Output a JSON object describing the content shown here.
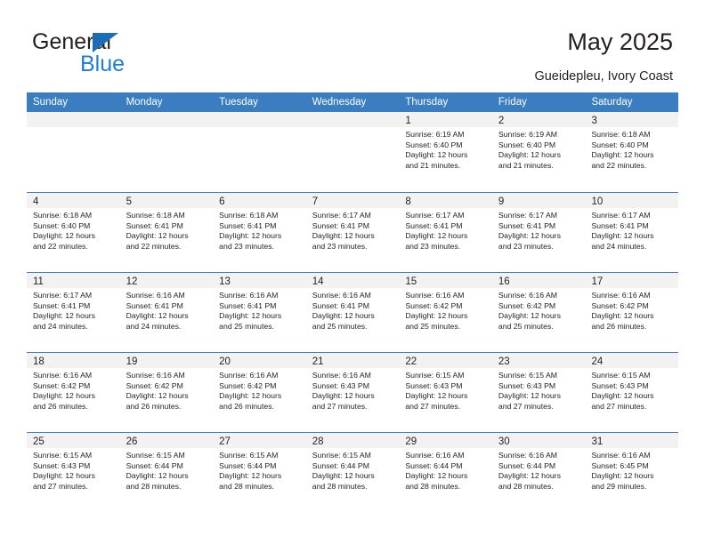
{
  "brand": {
    "name_part1": "General",
    "name_part2": "Blue",
    "triangle_color": "#1b6cb5",
    "blue_text_color": "#1b7fd4"
  },
  "header": {
    "title": "May 2025",
    "subtitle": "Gueidepleu, Ivory Coast"
  },
  "theme": {
    "header_blue": "#3a7dc0",
    "day_band_gray": "#f2f2f2",
    "text_color": "#231f20"
  },
  "calendar": {
    "weekdays": [
      "Sunday",
      "Monday",
      "Tuesday",
      "Wednesday",
      "Thursday",
      "Friday",
      "Saturday"
    ],
    "weeks": [
      [
        {
          "empty": true
        },
        {
          "empty": true
        },
        {
          "empty": true
        },
        {
          "empty": true
        },
        {
          "day": "1",
          "line1": "Sunrise: 6:19 AM",
          "line2": "Sunset: 6:40 PM",
          "line3": "Daylight: 12 hours",
          "line4": "and 21 minutes."
        },
        {
          "day": "2",
          "line1": "Sunrise: 6:19 AM",
          "line2": "Sunset: 6:40 PM",
          "line3": "Daylight: 12 hours",
          "line4": "and 21 minutes."
        },
        {
          "day": "3",
          "line1": "Sunrise: 6:18 AM",
          "line2": "Sunset: 6:40 PM",
          "line3": "Daylight: 12 hours",
          "line4": "and 22 minutes."
        }
      ],
      [
        {
          "day": "4",
          "line1": "Sunrise: 6:18 AM",
          "line2": "Sunset: 6:40 PM",
          "line3": "Daylight: 12 hours",
          "line4": "and 22 minutes."
        },
        {
          "day": "5",
          "line1": "Sunrise: 6:18 AM",
          "line2": "Sunset: 6:41 PM",
          "line3": "Daylight: 12 hours",
          "line4": "and 22 minutes."
        },
        {
          "day": "6",
          "line1": "Sunrise: 6:18 AM",
          "line2": "Sunset: 6:41 PM",
          "line3": "Daylight: 12 hours",
          "line4": "and 23 minutes."
        },
        {
          "day": "7",
          "line1": "Sunrise: 6:17 AM",
          "line2": "Sunset: 6:41 PM",
          "line3": "Daylight: 12 hours",
          "line4": "and 23 minutes."
        },
        {
          "day": "8",
          "line1": "Sunrise: 6:17 AM",
          "line2": "Sunset: 6:41 PM",
          "line3": "Daylight: 12 hours",
          "line4": "and 23 minutes."
        },
        {
          "day": "9",
          "line1": "Sunrise: 6:17 AM",
          "line2": "Sunset: 6:41 PM",
          "line3": "Daylight: 12 hours",
          "line4": "and 23 minutes."
        },
        {
          "day": "10",
          "line1": "Sunrise: 6:17 AM",
          "line2": "Sunset: 6:41 PM",
          "line3": "Daylight: 12 hours",
          "line4": "and 24 minutes."
        }
      ],
      [
        {
          "day": "11",
          "line1": "Sunrise: 6:17 AM",
          "line2": "Sunset: 6:41 PM",
          "line3": "Daylight: 12 hours",
          "line4": "and 24 minutes."
        },
        {
          "day": "12",
          "line1": "Sunrise: 6:16 AM",
          "line2": "Sunset: 6:41 PM",
          "line3": "Daylight: 12 hours",
          "line4": "and 24 minutes."
        },
        {
          "day": "13",
          "line1": "Sunrise: 6:16 AM",
          "line2": "Sunset: 6:41 PM",
          "line3": "Daylight: 12 hours",
          "line4": "and 25 minutes."
        },
        {
          "day": "14",
          "line1": "Sunrise: 6:16 AM",
          "line2": "Sunset: 6:41 PM",
          "line3": "Daylight: 12 hours",
          "line4": "and 25 minutes."
        },
        {
          "day": "15",
          "line1": "Sunrise: 6:16 AM",
          "line2": "Sunset: 6:42 PM",
          "line3": "Daylight: 12 hours",
          "line4": "and 25 minutes."
        },
        {
          "day": "16",
          "line1": "Sunrise: 6:16 AM",
          "line2": "Sunset: 6:42 PM",
          "line3": "Daylight: 12 hours",
          "line4": "and 25 minutes."
        },
        {
          "day": "17",
          "line1": "Sunrise: 6:16 AM",
          "line2": "Sunset: 6:42 PM",
          "line3": "Daylight: 12 hours",
          "line4": "and 26 minutes."
        }
      ],
      [
        {
          "day": "18",
          "line1": "Sunrise: 6:16 AM",
          "line2": "Sunset: 6:42 PM",
          "line3": "Daylight: 12 hours",
          "line4": "and 26 minutes."
        },
        {
          "day": "19",
          "line1": "Sunrise: 6:16 AM",
          "line2": "Sunset: 6:42 PM",
          "line3": "Daylight: 12 hours",
          "line4": "and 26 minutes."
        },
        {
          "day": "20",
          "line1": "Sunrise: 6:16 AM",
          "line2": "Sunset: 6:42 PM",
          "line3": "Daylight: 12 hours",
          "line4": "and 26 minutes."
        },
        {
          "day": "21",
          "line1": "Sunrise: 6:16 AM",
          "line2": "Sunset: 6:43 PM",
          "line3": "Daylight: 12 hours",
          "line4": "and 27 minutes."
        },
        {
          "day": "22",
          "line1": "Sunrise: 6:15 AM",
          "line2": "Sunset: 6:43 PM",
          "line3": "Daylight: 12 hours",
          "line4": "and 27 minutes."
        },
        {
          "day": "23",
          "line1": "Sunrise: 6:15 AM",
          "line2": "Sunset: 6:43 PM",
          "line3": "Daylight: 12 hours",
          "line4": "and 27 minutes."
        },
        {
          "day": "24",
          "line1": "Sunrise: 6:15 AM",
          "line2": "Sunset: 6:43 PM",
          "line3": "Daylight: 12 hours",
          "line4": "and 27 minutes."
        }
      ],
      [
        {
          "day": "25",
          "line1": "Sunrise: 6:15 AM",
          "line2": "Sunset: 6:43 PM",
          "line3": "Daylight: 12 hours",
          "line4": "and 27 minutes."
        },
        {
          "day": "26",
          "line1": "Sunrise: 6:15 AM",
          "line2": "Sunset: 6:44 PM",
          "line3": "Daylight: 12 hours",
          "line4": "and 28 minutes."
        },
        {
          "day": "27",
          "line1": "Sunrise: 6:15 AM",
          "line2": "Sunset: 6:44 PM",
          "line3": "Daylight: 12 hours",
          "line4": "and 28 minutes."
        },
        {
          "day": "28",
          "line1": "Sunrise: 6:15 AM",
          "line2": "Sunset: 6:44 PM",
          "line3": "Daylight: 12 hours",
          "line4": "and 28 minutes."
        },
        {
          "day": "29",
          "line1": "Sunrise: 6:16 AM",
          "line2": "Sunset: 6:44 PM",
          "line3": "Daylight: 12 hours",
          "line4": "and 28 minutes."
        },
        {
          "day": "30",
          "line1": "Sunrise: 6:16 AM",
          "line2": "Sunset: 6:44 PM",
          "line3": "Daylight: 12 hours",
          "line4": "and 28 minutes."
        },
        {
          "day": "31",
          "line1": "Sunrise: 6:16 AM",
          "line2": "Sunset: 6:45 PM",
          "line3": "Daylight: 12 hours",
          "line4": "and 29 minutes."
        }
      ]
    ]
  }
}
